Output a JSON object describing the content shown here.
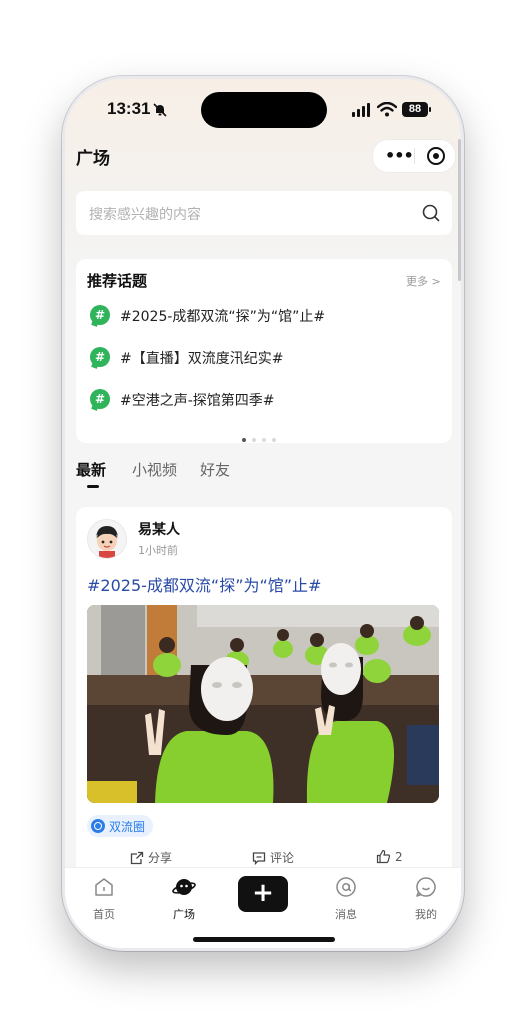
{
  "status_bar": {
    "time": "13:31",
    "battery": "88"
  },
  "header": {
    "title": "广场"
  },
  "search": {
    "placeholder": "搜索感兴趣的内容"
  },
  "topics": {
    "heading": "推荐话题",
    "more": "更多 >",
    "items": [
      {
        "label": "#2025-成都双流“探”为“馆”止#"
      },
      {
        "label": "#【直播】双流度汛纪实#"
      },
      {
        "label": "#空港之声-探馆第四季#"
      }
    ]
  },
  "feed_tabs": [
    {
      "label": "最新",
      "active": true
    },
    {
      "label": "小视频",
      "active": false
    },
    {
      "label": "好友",
      "active": false
    }
  ],
  "post": {
    "author": "易某人",
    "time": "1小时前",
    "title": "#2025-成都双流“探”为“馆”止#",
    "circle": "双流圈",
    "share": "分享",
    "comment": "评论",
    "likes": "2"
  },
  "tabbar": {
    "items": [
      {
        "label": "首页",
        "icon": "home-icon"
      },
      {
        "label": "广场",
        "icon": "planet-icon"
      },
      {
        "label": "",
        "icon": "plus-icon"
      },
      {
        "label": "消息",
        "icon": "at-icon"
      },
      {
        "label": "我的",
        "icon": "smile-icon"
      }
    ]
  },
  "colors": {
    "accent_green": "#2fb45b",
    "link_blue": "#2a4aa8",
    "chip_blue": "#2b7de9"
  }
}
